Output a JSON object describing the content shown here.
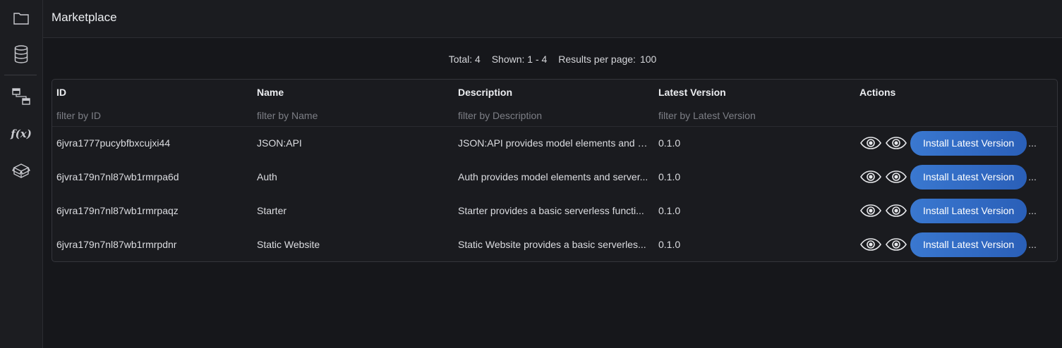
{
  "page": {
    "title": "Marketplace"
  },
  "sidebar": {
    "icons": [
      "folder-icon",
      "database-icon",
      "models-icon",
      "functions-icon",
      "marketplace-icon"
    ]
  },
  "summary": {
    "total": "Total: 4",
    "shown": "Shown: 1 - 4",
    "per_page_label": "Results per page:",
    "per_page_value": "100"
  },
  "table": {
    "columns": [
      "ID",
      "Name",
      "Description",
      "Latest Version",
      "Actions"
    ],
    "filters": {
      "id": "filter by ID",
      "name": "filter by Name",
      "description": "filter by Description",
      "version": "filter by Latest Version"
    },
    "rows": [
      {
        "id": "6jvra1777pucybfbxcujxi44",
        "name": "JSON:API",
        "description": "JSON:API provides model elements and s...",
        "version": "0.1.0",
        "button": "Install Latest Version",
        "more": "..."
      },
      {
        "id": "6jvra179n7nl87wb1rmrpa6d",
        "name": "Auth",
        "description": "Auth provides model elements and server...",
        "version": "0.1.0",
        "button": "Install Latest Version",
        "more": "..."
      },
      {
        "id": "6jvra179n7nl87wb1rmrpaqz",
        "name": "Starter",
        "description": "Starter provides a basic serverless functi...",
        "version": "0.1.0",
        "button": "Install Latest Version",
        "more": "..."
      },
      {
        "id": "6jvra179n7nl87wb1rmrpdnr",
        "name": "Static Website",
        "description": "Static Website provides a basic serverles...",
        "version": "0.1.0",
        "button": "Install Latest Version",
        "more": "..."
      }
    ]
  },
  "colors": {
    "accent": "#3a78d0",
    "background": "#16171b"
  }
}
